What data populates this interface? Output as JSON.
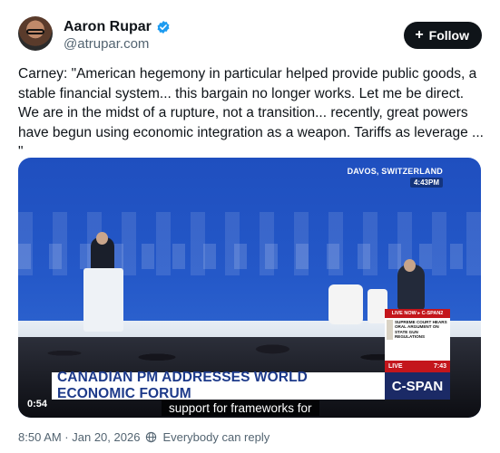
{
  "author": {
    "name": "Aaron Rupar",
    "handle": "@atrupar.com"
  },
  "follow_button": {
    "label": "Follow"
  },
  "post_text": "Carney: \"American hegemony in particular helped provide public goods, a stable financial system... this bargain no longer works. Let me be direct. We are in the midst of a rupture, not a transition... recently, great powers have begun using economic integration as a weapon. Tariffs as leverage ... \"",
  "video": {
    "location": "DAVOS, SWITZERLAND",
    "clock": "4:43PM",
    "live_header": "LIVE NOW ▸ C-SPAN2",
    "live_description": "SUPREME COURT HEARS ORAL ARGUMENT ON STATE GUN REGULATIONS",
    "live_label": "LIVE",
    "live_time": "7:43",
    "banner_text": "CANADIAN PM ADDRESSES WORLD ECONOMIC FORUM",
    "network": "C-SPAN",
    "caption": "support for frameworks for",
    "duration": "0:54"
  },
  "footer": {
    "timestamp": "8:50 AM · Jan 20, 2026",
    "reply_setting": "Everybody can reply"
  },
  "colors": {
    "verified": "#1d9bf0",
    "follow_bg": "#0f1419",
    "muted_text": "#536471"
  }
}
